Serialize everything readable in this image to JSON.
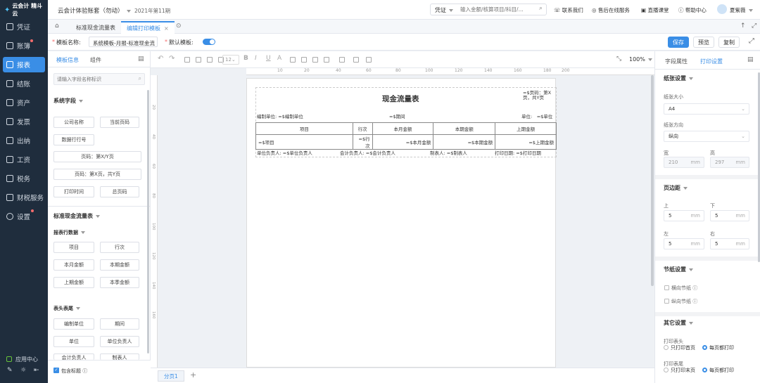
{
  "brand": {
    "name": "云会计 精斗云"
  },
  "nav": {
    "items": [
      "凭证",
      "账簿",
      "报表",
      "结账",
      "资产",
      "发票",
      "出纳",
      "工资",
      "税务",
      "财税服务",
      "设置"
    ],
    "app_center": "应用中心"
  },
  "topbar": {
    "account": "云会计体验账套（勿动）",
    "period": "2021年第11期",
    "search_type": "凭证",
    "search_placeholder": "输入金额/核算项目/科目/...",
    "links": [
      "联系我们",
      "售后在线服务",
      "直播课堂",
      "帮助中心"
    ],
    "user": "夏紫薇"
  },
  "tabs": [
    "标准现金流量表",
    "编辑打印模板"
  ],
  "toolbar": {
    "template_label": "模板名称:",
    "template_value": "系统模板-月报-标准现金流",
    "default_label": "默认模板:",
    "save": "保存",
    "preview": "预览",
    "copy": "复制"
  },
  "left": {
    "tabs": [
      "模板信息",
      "组件"
    ],
    "search_placeholder": "请输入字段名称标识",
    "sys_fields_title": "系统字段",
    "sys_fields": [
      "公司名称",
      "当前页码",
      "数据行行号"
    ],
    "sys_fields_wide": [
      "页码：第X/Y页",
      "页码：第X页，共Y页"
    ],
    "sys_fields2": [
      "打印时间",
      "总页码"
    ],
    "std_title": "标准现金流量表",
    "row_data_title": "报表行数据",
    "row_data": [
      "项目",
      "行次",
      "本月金额",
      "本期金额",
      "上期金额",
      "本季金额"
    ],
    "header_footer_title": "表头表尾",
    "header_footer": [
      "编制单位",
      "期间",
      "单位",
      "单位负责人",
      "会计负责人",
      "制表人"
    ],
    "include_title": "包含标题"
  },
  "editor": {
    "zoom": "100%",
    "font_size": "12",
    "ruler_h": [
      "10",
      "20",
      "40",
      "60",
      "80",
      "100",
      "120",
      "140",
      "160",
      "180",
      "200"
    ],
    "ruler_v": [
      "20",
      "40",
      "60",
      "80",
      "100",
      "120",
      "140",
      "160"
    ],
    "sheet": "分页1"
  },
  "report": {
    "title": "现金流量表",
    "page_info": "=$页码：第X页，共Y页",
    "unit_label": "编制单位: =$编制单位",
    "period": "=$期间",
    "unit": "单位:　=$单位",
    "headers": [
      "项目",
      "行次",
      "本月金额",
      "本期金额",
      "上期金额"
    ],
    "row": [
      "=$项目",
      "=$行次",
      "=$本月金额",
      "=$本期金额",
      "=$上期金额"
    ],
    "footer": [
      "单位负责人: =$单位负责人",
      "会计负责人: =$会计负责人",
      "制表人: =$制表人",
      "打印日期: =$打印日期"
    ]
  },
  "right": {
    "tabs": [
      "字段属性",
      "打印设置"
    ],
    "paper_title": "纸张设置",
    "paper_size_label": "纸张大小",
    "paper_size": "A4",
    "orient_label": "纸张方向",
    "orient": "纵向",
    "width_label": "宽",
    "width": "210",
    "height_label": "高",
    "height": "297",
    "unit": "mm",
    "margin_title": "页边距",
    "top_label": "上",
    "top": "5",
    "bottom_label": "下",
    "bottom": "5",
    "left_label": "左",
    "left": "5",
    "right_label": "右",
    "right": "5",
    "section_title": "节纸设置",
    "horizontal": "横向节纸",
    "vertical": "纵向节纸",
    "other_title": "其它设置",
    "print_header": "打印表头",
    "print_header_opts": [
      "只打印首页",
      "每页都打印"
    ],
    "print_footer": "打印表尾",
    "print_footer_opts": [
      "只打印末页",
      "每页都打印"
    ]
  },
  "colors": {
    "accent": "#3a8ee6",
    "nav_bg": "#1f2d3d"
  }
}
